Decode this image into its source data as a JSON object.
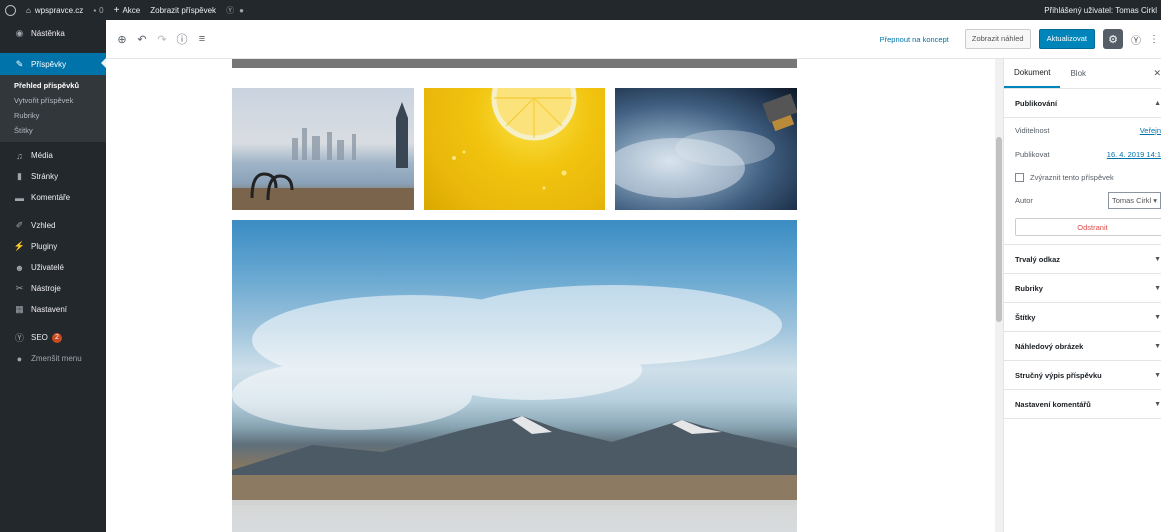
{
  "admin_bar": {
    "site_name": "wpspravce.cz",
    "comments_count": "0",
    "new_label": "Akce",
    "view_post_label": "Zobrazit příspěvek",
    "user_greeting": "Přihlášený uživatel: Tomas Cirkl"
  },
  "sidebar": {
    "dashboard": "Nástěnka",
    "posts": "Příspěvky",
    "posts_submenu": [
      "Přehled příspěvků",
      "Vytvořit příspěvek",
      "Rubriky",
      "Štítky"
    ],
    "media": "Média",
    "pages": "Stránky",
    "comments": "Komentáře",
    "appearance": "Vzhled",
    "plugins": "Pluginy",
    "users": "Uživatelé",
    "tools": "Nástroje",
    "settings": "Nastavení",
    "seo": "SEO",
    "seo_badge": "2",
    "collapse": "Zmenšit menu"
  },
  "toolbar": {
    "switch_draft": "Přepnout na koncept",
    "preview": "Zobrazit náhled",
    "update": "Aktualizovat"
  },
  "panel": {
    "tabs": [
      "Dokument",
      "Blok"
    ],
    "publish": {
      "title": "Publikování",
      "visibility_label": "Viditelnost",
      "visibility_value": "Veřejn",
      "publish_label": "Publikovat",
      "publish_value": "16. 4. 2019 14:1",
      "sticky_label": "Zvýraznit tento příspěvek",
      "author_label": "Autor",
      "author_value": "Tomas Cirkl",
      "delete": "Odstranit"
    },
    "sections": [
      "Trvalý odkaz",
      "Rubriky",
      "Štítky",
      "Náhledový obrázek",
      "Stručný výpis příspěvku",
      "Nastavení komentářů"
    ]
  },
  "icons": {
    "wp_logo": "wordpress-icon",
    "home": "home-icon",
    "comment": "comment-icon",
    "plus": "plus-icon",
    "yoast": "yoast-icon"
  }
}
